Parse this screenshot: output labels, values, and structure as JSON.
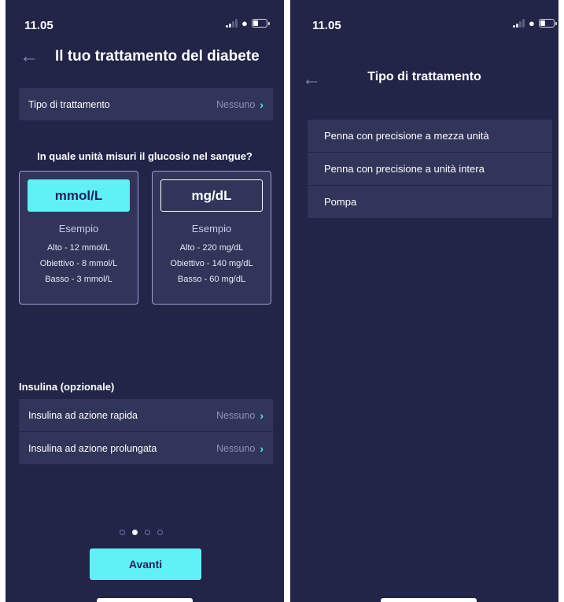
{
  "status": {
    "time": "11.05"
  },
  "left": {
    "title": "Il tuo trattamento del diabete",
    "treatment_row": {
      "label": "Tipo di trattamento",
      "value": "Nessuno"
    },
    "question": "In quale unità misuri il glucosio nel sangue?",
    "units": [
      {
        "label": "mmol/L",
        "example_title": "Esempio",
        "high": "Alto - 12 mmol/L",
        "target": "Obiettivo - 8 mmol/L",
        "low": "Basso - 3 mmol/L",
        "selected": true
      },
      {
        "label": "mg/dL",
        "example_title": "Esempio",
        "high": "Alto - 220 mg/dL",
        "target": "Obiettivo - 140 mg/dL",
        "low": "Basso - 60 mg/dL",
        "selected": false
      }
    ],
    "insulin_section": "Insulina (opzionale)",
    "insulin_rows": [
      {
        "label": "Insulina ad azione rapida",
        "value": "Nessuno"
      },
      {
        "label": "Insulina ad azione prolungata",
        "value": "Nessuno"
      }
    ],
    "pagination": {
      "current": 2,
      "total": 4
    },
    "next_button": "Avanti"
  },
  "right": {
    "title": "Tipo di trattamento",
    "options": [
      "Penna con precisione a mezza unità",
      "Penna con precisione a unità intera",
      "Pompa"
    ]
  },
  "colors": {
    "background": "#222448",
    "surface": "#32355a",
    "accent": "#5ff1f6"
  },
  "icons": {
    "back": "arrow-left-icon",
    "chevron": "chevron-right-icon",
    "signal": "signal-icon",
    "wifi": "wifi-icon",
    "battery": "battery-icon"
  }
}
